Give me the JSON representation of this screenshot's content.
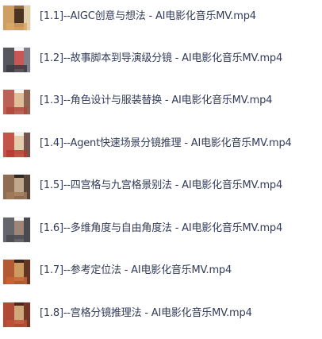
{
  "file_list": {
    "items": [
      {
        "label": "[1.1]--AIGC创意与想法 - AI电影化音乐MV.mp4",
        "thumbnail": "video-thumbnail-icon",
        "colors": [
          "#8a6a3c",
          "#d8a86a",
          "#3d2a1e",
          "#f1e1c0"
        ]
      },
      {
        "label": "[1.2]--故事脚本到导演级分镜 - AI电影化音乐MV.mp4",
        "thumbnail": "video-thumbnail-icon",
        "colors": [
          "#f3f3f3",
          "#3a3a42",
          "#c23a3a",
          "#6b6b74"
        ]
      },
      {
        "label": "[1.3]--角色设计与服装替换 - AI电影化音乐MV.mp4",
        "thumbnail": "video-thumbnail-icon",
        "colors": [
          "#faf7f2",
          "#b0463c",
          "#d9b48a",
          "#7a4a3a"
        ]
      },
      {
        "label": "[1.4]--Agent快速场景分镜推理 - AI电影化音乐MV.mp4",
        "thumbnail": "video-thumbnail-icon",
        "colors": [
          "#f4f0ea",
          "#b9382e",
          "#e0c6a2",
          "#5a3a32"
        ]
      },
      {
        "label": "[1.5]--四宫格与九宫格景别法 - AI电影化音乐MV.mp4",
        "thumbnail": "video-thumbnail-icon",
        "colors": [
          "#2e2622",
          "#a07a5a",
          "#d8c0a0",
          "#5e4a3c"
        ]
      },
      {
        "label": "[1.6]--多维角度与自由角度法 - AI电影化音乐MV.mp4",
        "thumbnail": "video-thumbnail-icon",
        "colors": [
          "#fbfbfb",
          "#4a4a52",
          "#8c7060",
          "#2a2a30"
        ]
      },
      {
        "label": "[1.7]--参考定位法 - AI电影化音乐MV.mp4",
        "thumbnail": "video-thumbnail-icon",
        "colors": [
          "#3a2418",
          "#c9643a",
          "#e8b070",
          "#6a3a24"
        ]
      },
      {
        "label": "[1.8]--宫格分镜推理法 - AI电影化音乐MV.mp4",
        "thumbnail": "video-thumbnail-icon",
        "colors": [
          "#4a2a1c",
          "#c0503a",
          "#e6c08a",
          "#7a3a28"
        ]
      }
    ]
  }
}
